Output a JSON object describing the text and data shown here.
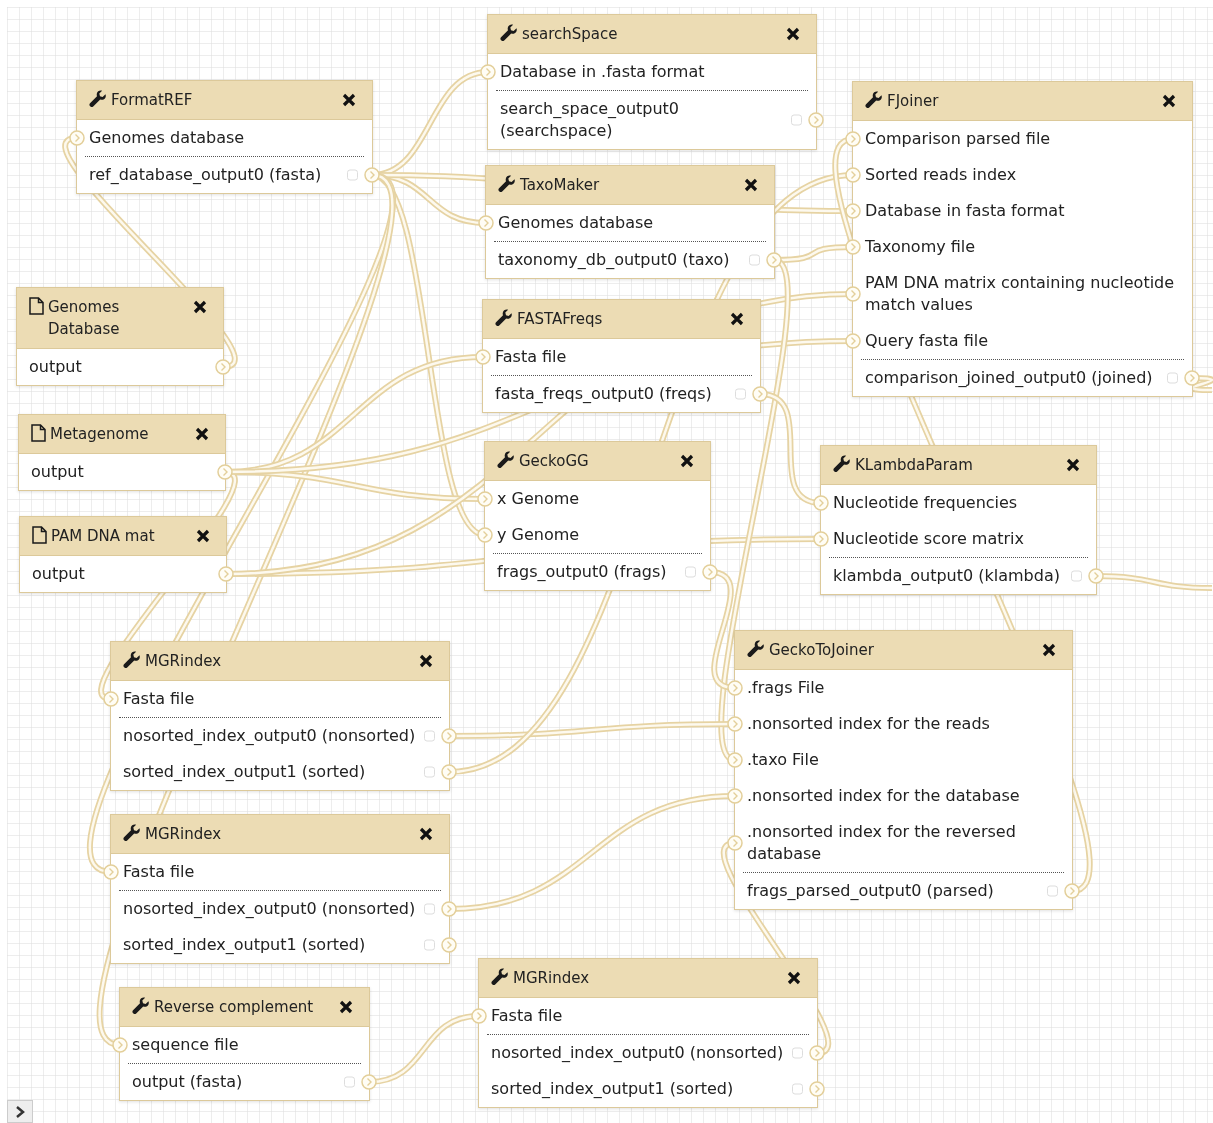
{
  "nodes": [
    {
      "kind": "tool",
      "title": "searchSpace",
      "inputs": [
        "Database in .fasta format"
      ],
      "outputs": [
        {
          "label": "search_space_output0 (searchspace)",
          "checked": false
        }
      ]
    },
    {
      "kind": "tool",
      "title": "FormatREF",
      "inputs": [
        "Genomes database"
      ],
      "outputs": [
        {
          "label": "ref_database_output0 (fasta)",
          "checked": false
        }
      ]
    },
    {
      "kind": "tool",
      "title": "FJoiner",
      "inputs": [
        "Comparison parsed file",
        "Sorted reads index",
        "Database in fasta format",
        "Taxonomy file",
        "PAM DNA matrix containing nucleotide match values",
        "Query fasta file"
      ],
      "outputs": [
        {
          "label": "comparison_joined_output0 (joined)",
          "checked": false
        }
      ]
    },
    {
      "kind": "tool",
      "title": "TaxoMaker",
      "inputs": [
        "Genomes database"
      ],
      "outputs": [
        {
          "label": "taxonomy_db_output0 (taxo)",
          "checked": false
        }
      ]
    },
    {
      "kind": "input",
      "title": "Genomes Database",
      "outputs": [
        {
          "label": "output"
        }
      ]
    },
    {
      "kind": "tool",
      "title": "FASTAFreqs",
      "inputs": [
        "Fasta file"
      ],
      "outputs": [
        {
          "label": "fasta_freqs_output0 (freqs)",
          "checked": false
        }
      ]
    },
    {
      "kind": "input",
      "title": "Metagenome",
      "outputs": [
        {
          "label": "output"
        }
      ]
    },
    {
      "kind": "input",
      "title": "PAM DNA mat",
      "outputs": [
        {
          "label": "output"
        }
      ]
    },
    {
      "kind": "tool",
      "title": "GeckoGG",
      "inputs": [
        "x Genome",
        "y Genome"
      ],
      "outputs": [
        {
          "label": "frags_output0 (frags)",
          "checked": false
        }
      ]
    },
    {
      "kind": "tool",
      "title": "KLambdaParam",
      "inputs": [
        "Nucleotide frequencies",
        "Nucleotide score matrix"
      ],
      "outputs": [
        {
          "label": "klambda_output0 (klambda)",
          "checked": false
        }
      ]
    },
    {
      "kind": "tool",
      "title": "MGRindex",
      "inputs": [
        "Fasta file"
      ],
      "outputs": [
        {
          "label": "nosorted_index_output0 (nonsorted)",
          "checked": false
        },
        {
          "label": "sorted_index_output1 (sorted)",
          "checked": false
        }
      ]
    },
    {
      "kind": "tool",
      "title": "GeckoToJoiner",
      "inputs": [
        ".frags File",
        ".nonsorted index for the reads",
        ".taxo File",
        ".nonsorted index for the database",
        ".nonsorted index for the reversed database"
      ],
      "outputs": [
        {
          "label": "frags_parsed_output0 (parsed)",
          "checked": false
        }
      ]
    },
    {
      "kind": "tool",
      "title": "MGRindex",
      "inputs": [
        "Fasta file"
      ],
      "outputs": [
        {
          "label": "nosorted_index_output0 (nonsorted)",
          "checked": false
        },
        {
          "label": "sorted_index_output1 (sorted)",
          "checked": false
        }
      ]
    },
    {
      "kind": "tool",
      "title": "Reverse complement",
      "inputs": [
        "sequence file"
      ],
      "outputs": [
        {
          "label": "output (fasta)",
          "checked": false
        }
      ]
    },
    {
      "kind": "tool",
      "title": "MGRindex",
      "inputs": [
        "Fasta file"
      ],
      "outputs": [
        {
          "label": "nosorted_index_output0 (nonsorted)",
          "checked": false
        },
        {
          "label": "sorted_index_output1 (sorted)",
          "checked": false
        }
      ]
    }
  ]
}
